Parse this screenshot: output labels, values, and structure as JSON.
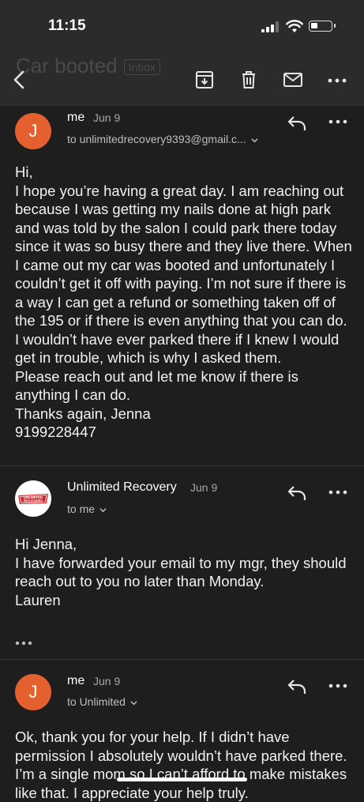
{
  "status_bar": {
    "time": "11:15"
  },
  "app_bar": {
    "subject": "Car booted",
    "label": "Inbox"
  },
  "messages": [
    {
      "avatar_letter": "J",
      "sender": "me",
      "date": "Jun 9",
      "recipients": "to unlimitedrecovery9393@gmail.c...",
      "body": "Hi,\nI hope you’re having a great day. I am reaching out because I was getting my nails done at high park and was told by the salon I could park there today since it was so busy there and they live there. When I came out my car was booted and unfortunately I couldn’t get it off with paying. I’m not sure if there is a way I can get a refund or something taken off of the 195 or if there is even anything that you can do. I wouldn’t have ever parked there if I knew I would get in trouble, which is why I asked them.\nPlease reach out and let me know if there is anything I can do.\nThanks again, Jenna\n9199228447"
    },
    {
      "avatar_logo_text": "UNLIMITED RECOVERY",
      "sender": "Unlimited Recovery",
      "date": "Jun 9",
      "recipients": "to me",
      "body": "Hi Jenna,\nI have forwarded your email to my mgr, they should reach out to you no later than Monday.\nLauren"
    },
    {
      "avatar_letter": "J",
      "sender": "me",
      "date": "Jun 9",
      "recipients": "to Unlimited",
      "body": "Ok, thank you for your help. If I didn’t have permission I absolutely wouldn’t have parked there. I’m a single mom so I can’t afford to make mistakes like that. I appreciate your help truly."
    }
  ],
  "colors": {
    "background": "#1e1e1f",
    "header": "#2b2b2d",
    "avatar": "#e4602e",
    "logo_red": "#d8252b"
  },
  "icons": [
    "back-arrow-icon",
    "archive-icon",
    "trash-icon",
    "mail-icon",
    "more-icon",
    "reply-icon",
    "chevron-down-icon",
    "signal-icon",
    "wifi-icon",
    "battery-icon"
  ]
}
